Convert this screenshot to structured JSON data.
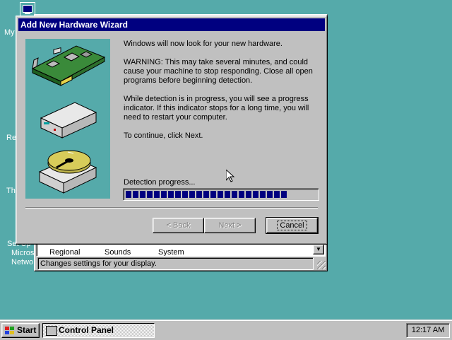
{
  "desktop": {
    "labels": [
      "My",
      "Re",
      "Th",
      "Set Up",
      "Micros",
      "Netwo"
    ]
  },
  "control_panel": {
    "items": [
      "Regional",
      "Sounds",
      "System"
    ],
    "status": "Changes settings for your display."
  },
  "wizard": {
    "title": "Add New Hardware Wizard",
    "para1": "Windows will now look for your new hardware.",
    "para2": "WARNING: This may take several minutes, and could cause your machine to stop responding. Close all open programs before beginning detection.",
    "para3": "While detection is in progress, you will see a progress indicator. If this indicator stops for a long time, you will need to restart your computer.",
    "para4": "To continue, click Next.",
    "progress_label": "Detection progress...",
    "progress_fraction": 0.87,
    "back_label": "< Back",
    "next_label": "Next >",
    "cancel_label": "Cancel"
  },
  "taskbar": {
    "start_label": "Start",
    "task_label": "Control Panel",
    "clock": "12:17 AM"
  },
  "icons": {
    "desktop": "my-computer-icon",
    "wizard_art": [
      "expansion-card-icon",
      "external-drive-icon",
      "hard-disk-icon"
    ],
    "start": "windows-logo-icon",
    "task": "control-panel-icon"
  },
  "colors": {
    "desktop": "#55aaaa",
    "title_bar": "#000080",
    "face": "#c0c0c0",
    "progress": "#000080"
  }
}
